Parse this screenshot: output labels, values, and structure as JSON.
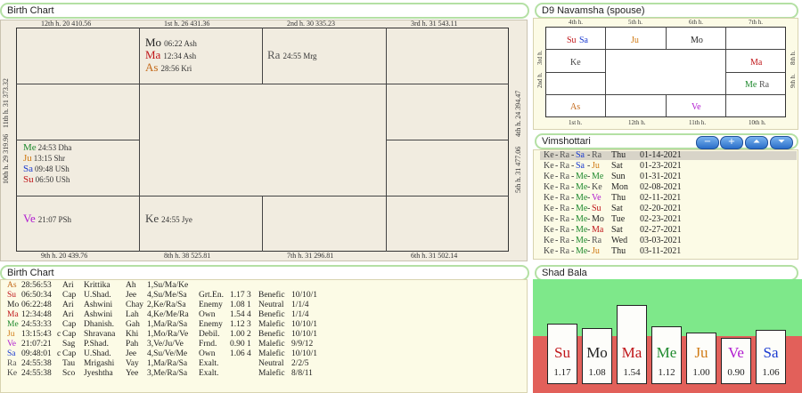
{
  "birth_chart": {
    "title": "Birth Chart",
    "top_houses": [
      "12th h.  20  410.56",
      "1st h.  26  431.36",
      "2nd h.  30  335.23",
      "3rd h.  31  543.11"
    ],
    "bottom_houses": [
      "9th h.  20  439.76",
      "8th h.  38  525.81",
      "7th h.  31  296.81",
      "6th h.  31  502.14"
    ],
    "left_houses": [
      "11th h.  31  373.32",
      "10th h.  29  319.96"
    ],
    "right_houses": [
      "4th h.  24  394.47",
      "5th h.  31  477.06"
    ],
    "house1": [
      {
        "g": "Mo",
        "d": "06:22 Ash",
        "c": "Mo"
      },
      {
        "g": "Ma",
        "d": "12:34 Ash",
        "c": "Ma"
      },
      {
        "g": "As",
        "d": "28:56 Kri",
        "c": "As"
      }
    ],
    "house2": [
      {
        "g": "Ra",
        "d": "24:55 Mrg",
        "c": "Ra"
      }
    ],
    "house10": [
      {
        "g": "Me",
        "d": "24:53 Dha",
        "c": "Me"
      },
      {
        "g": "Ju",
        "d": "13:15 Shr",
        "c": "Ju"
      },
      {
        "g": "Sa",
        "d": "09:48 USh",
        "c": "Sa"
      },
      {
        "g": "Su",
        "d": "06:50 USh",
        "c": "Su"
      }
    ],
    "house9": [
      {
        "g": "Ve",
        "d": "21:07 PSh",
        "c": "Ve"
      }
    ],
    "house8": [
      {
        "g": "Ke",
        "d": "24:55 Jye",
        "c": "Ke"
      }
    ]
  },
  "navamsha": {
    "title": "D9 Navamsha  (spouse)",
    "top_labels": [
      "4th h.",
      "5th h.",
      "6th h.",
      "7th h."
    ],
    "bottom_labels": [
      "1st h.",
      "12th h.",
      "11th h.",
      "10th h."
    ],
    "left_labels": [
      "3rd h.",
      "2nd h."
    ],
    "right_labels": [
      "8th h.",
      "9th h."
    ],
    "cells": {
      "c4a": "Su",
      "c4b": "Sa",
      "c5": "Ju",
      "c6": "Mo",
      "c3": "Ke",
      "c8": "Ma",
      "c9a": "Me",
      "c9b": "Ra",
      "c1": "As",
      "c11": "Ve"
    }
  },
  "vimshottari": {
    "title": "Vimshottari",
    "buttons": [
      "−",
      "+",
      "⏶",
      "⏷"
    ],
    "rows": [
      {
        "p": [
          "Ke",
          "Ra",
          "Sa",
          "Ra"
        ],
        "day": "Thu",
        "date": "01-14-2021",
        "sel": true
      },
      {
        "p": [
          "Ke",
          "Ra",
          "Sa",
          "Ju"
        ],
        "day": "Sat",
        "date": "01-23-2021"
      },
      {
        "p": [
          "Ke",
          "Ra",
          "Me",
          "Me"
        ],
        "day": "Sun",
        "date": "01-31-2021"
      },
      {
        "p": [
          "Ke",
          "Ra",
          "Me",
          "Ke"
        ],
        "day": "Mon",
        "date": "02-08-2021"
      },
      {
        "p": [
          "Ke",
          "Ra",
          "Me",
          "Ve"
        ],
        "day": "Thu",
        "date": "02-11-2021"
      },
      {
        "p": [
          "Ke",
          "Ra",
          "Me",
          "Su"
        ],
        "day": "Sat",
        "date": "02-20-2021"
      },
      {
        "p": [
          "Ke",
          "Ra",
          "Me",
          "Mo"
        ],
        "day": "Tue",
        "date": "02-23-2021"
      },
      {
        "p": [
          "Ke",
          "Ra",
          "Me",
          "Ma"
        ],
        "day": "Sat",
        "date": "02-27-2021"
      },
      {
        "p": [
          "Ke",
          "Ra",
          "Me",
          "Ra"
        ],
        "day": "Wed",
        "date": "03-03-2021"
      },
      {
        "p": [
          "Ke",
          "Ra",
          "Me",
          "Ju"
        ],
        "day": "Thu",
        "date": "03-11-2021"
      }
    ]
  },
  "planet_table": {
    "title": "Birth Chart",
    "rows": [
      {
        "g": "As",
        "deg": "28:56:53",
        "r": "",
        "sign": "Ari",
        "nak": "Krittika",
        "lord": "Ah",
        "pada": "1,Su/Ma/Ke",
        "dig": "",
        "sb": "",
        "nat": "",
        "val": ""
      },
      {
        "g": "Su",
        "deg": "06:50:34",
        "r": "",
        "sign": "Cap",
        "nak": "U.Shad.",
        "lord": "Jee",
        "pada": "4,Su/Me/Sa",
        "dig": "Grt.En.",
        "sb": "1.17  3",
        "nat": "Benefic",
        "val": "10/10/1"
      },
      {
        "g": "Mo",
        "deg": "06:22:48",
        "r": "",
        "sign": "Ari",
        "nak": "Ashwini",
        "lord": "Chay",
        "pada": "2,Ke/Ra/Sa",
        "dig": "Enemy",
        "sb": "1.08  1",
        "nat": "Neutral",
        "val": "1/1/4"
      },
      {
        "g": "Ma",
        "deg": "12:34:48",
        "r": "",
        "sign": "Ari",
        "nak": "Ashwini",
        "lord": "Lah",
        "pada": "4,Ke/Me/Ra",
        "dig": "Own",
        "sb": "1.54  4",
        "nat": "Benefic",
        "val": "1/1/4"
      },
      {
        "g": "Me",
        "deg": "24:53:33",
        "r": "",
        "sign": "Cap",
        "nak": "Dhanish.",
        "lord": "Gah",
        "pada": "1,Ma/Ra/Sa",
        "dig": "Enemy",
        "sb": "1.12  3",
        "nat": "Malefic",
        "val": "10/10/1"
      },
      {
        "g": "Ju",
        "deg": "13:15:43",
        "r": "c",
        "sign": "Cap",
        "nak": "Shravana",
        "lord": "Khi",
        "pada": "1,Mo/Ra/Ve",
        "dig": "Debil.",
        "sb": "1.00  2",
        "nat": "Benefic",
        "val": "10/10/1"
      },
      {
        "g": "Ve",
        "deg": "21:07:21",
        "r": "",
        "sign": "Sag",
        "nak": "P.Shad.",
        "lord": "Pah",
        "pada": "3,Ve/Ju/Ve",
        "dig": "Frnd.",
        "sb": "0.90  1",
        "nat": "Malefic",
        "val": "9/9/12"
      },
      {
        "g": "Sa",
        "deg": "09:48:01",
        "r": "c",
        "sign": "Cap",
        "nak": "U.Shad.",
        "lord": "Jee",
        "pada": "4,Su/Ve/Me",
        "dig": "Own",
        "sb": "1.06  4",
        "nat": "Malefic",
        "val": "10/10/1"
      },
      {
        "g": "Ra",
        "deg": "24:55:38",
        "r": "",
        "sign": "Tau",
        "nak": "Mrigashi",
        "lord": "Vay",
        "pada": "1,Ma/Ra/Sa",
        "dig": "Exalt.",
        "sb": "",
        "nat": "Neutral",
        "val": "2/2/5"
      },
      {
        "g": "Ke",
        "deg": "24:55:38",
        "r": "",
        "sign": "Sco",
        "nak": "Jyeshtha",
        "lord": "Yee",
        "pada": "3,Me/Ra/Sa",
        "dig": "Exalt.",
        "sb": "",
        "nat": "Malefic",
        "val": "8/8/11"
      }
    ]
  },
  "shad_bala": {
    "title": "Shad Bala",
    "colors": {
      "background": "#7ee88a",
      "lower": "#e2605a",
      "bar_border": "#222"
    },
    "bars": [
      {
        "g": "Su",
        "v": "1.17",
        "value": 1.17,
        "c": "Su"
      },
      {
        "g": "Mo",
        "v": "1.08",
        "value": 1.08,
        "c": "Mo"
      },
      {
        "g": "Ma",
        "v": "1.54",
        "value": 1.54,
        "c": "Ma"
      },
      {
        "g": "Me",
        "v": "1.12",
        "value": 1.12,
        "c": "Me"
      },
      {
        "g": "Ju",
        "v": "1.00",
        "value": 1.0,
        "c": "Ju"
      },
      {
        "g": "Ve",
        "v": "0.90",
        "value": 0.9,
        "c": "Ve"
      },
      {
        "g": "Sa",
        "v": "1.06",
        "value": 1.06,
        "c": "Sa"
      }
    ]
  }
}
